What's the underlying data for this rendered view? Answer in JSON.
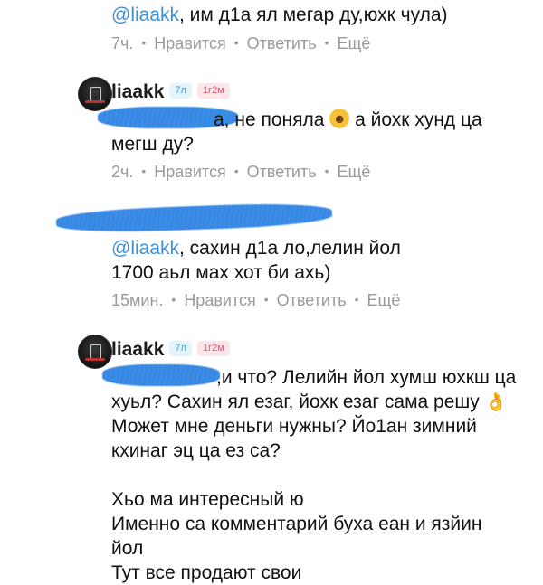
{
  "comments": [
    {
      "mention": "@liaakk",
      "text": ", им д1а ял мегар ду,юхк чула)",
      "time": "7ч.",
      "like": "Нравится",
      "reply": "Ответить",
      "more": "Ещё"
    },
    {
      "username": "liaakk",
      "badge1": "7л",
      "badge2": "1г2м",
      "line1_visible": "а, не поняла",
      "line1_after_emoji": "а йохк хунд ца",
      "line2": "мегш ду?",
      "emoji": "grinning-face-emoji",
      "time": "2ч.",
      "like": "Нравится",
      "reply": "Ответить",
      "more": "Ещё"
    },
    {
      "mention": "@liaakk",
      "line1": ", сахин д1а ло,лелин йол",
      "line2": "1700 аьл мах хот би ахь)",
      "time": "15мин.",
      "like": "Нравится",
      "reply": "Ответить",
      "more": "Ещё"
    },
    {
      "username": "liaakk",
      "badge1": "7л",
      "badge2": "1г2м",
      "line1_visible": ",и что? Лелийн йол хумш юхкш ца",
      "line2": "хуьл? Сахин ял езаг, йохк езаг сама решу",
      "line3": "Может мне деньги нужны? Йо1ан зимний",
      "line4": "кхинаг эц ца ез са?",
      "line5": "Хьо ма интересный ю",
      "line6": "Именно са комментарий буха еан и язйин",
      "line7": "йол",
      "line8": "Тут все продают свои",
      "emoji": "ok-hand-emoji"
    }
  ],
  "colors": {
    "mention": "#3d8fd6",
    "meta": "#9a9a9a",
    "redaction": "#3b8de5",
    "badge_blue": "#3aa3d8",
    "badge_pink": "#e0526b"
  }
}
